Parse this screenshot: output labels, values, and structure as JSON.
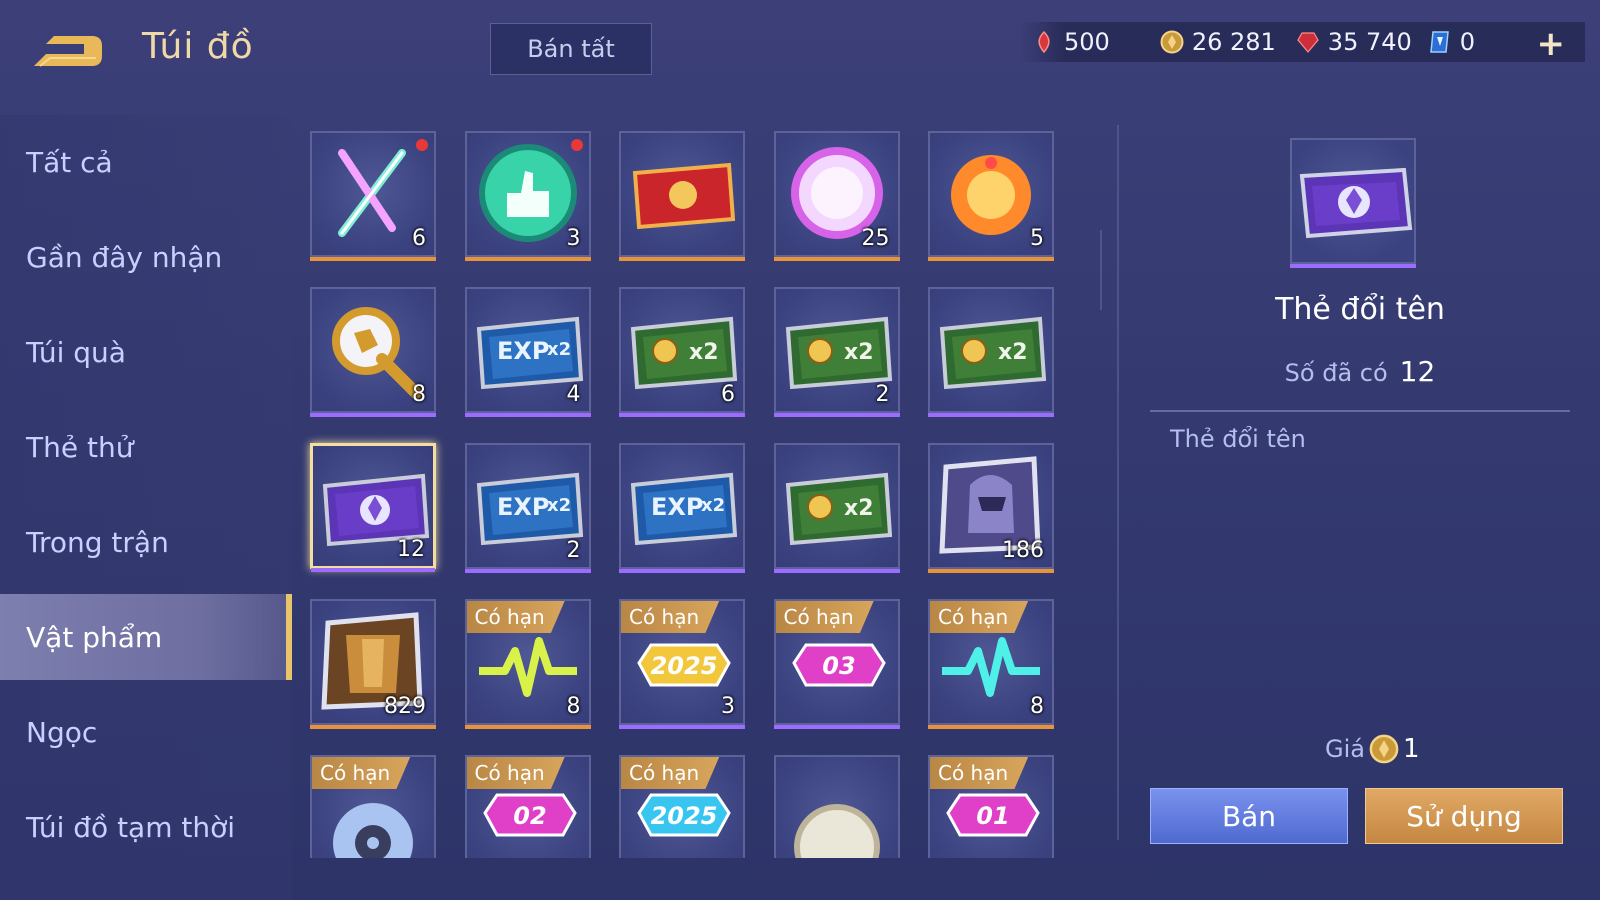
{
  "header": {
    "back_icon": "back-arrow-icon",
    "title": "Túi đồ",
    "sell_all_label": "Bán tất"
  },
  "currencies": [
    {
      "icon": "red-gem-icon",
      "value": "500",
      "color": "#e0484b"
    },
    {
      "icon": "gold-coin-icon",
      "value": "26 281",
      "color": "#e3b64b"
    },
    {
      "icon": "red-crystal-icon",
      "value": "35 740",
      "color": "#d9363c"
    },
    {
      "icon": "blue-voucher-icon",
      "value": "0",
      "color": "#5aa0ff"
    }
  ],
  "add_currency_label": "+",
  "sidebar": {
    "items": [
      {
        "label": "Tất cả"
      },
      {
        "label": "Gần đây nhận"
      },
      {
        "label": "Túi quà"
      },
      {
        "label": "Thẻ thử"
      },
      {
        "label": "Trong trận"
      },
      {
        "label": "Vật phẩm",
        "active": true
      },
      {
        "label": "Ngọc"
      },
      {
        "label": "Túi đồ tạm thời"
      }
    ]
  },
  "grid": {
    "limited_label": "Có hạn",
    "items": [
      {
        "icon": "crossed-lightsabers-icon",
        "count": "6",
        "rarity": "orange",
        "new": true
      },
      {
        "icon": "green-thumbs-up-icon",
        "count": "3",
        "rarity": "orange",
        "new": true
      },
      {
        "icon": "red-ticket-icon",
        "count": "",
        "rarity": "orange"
      },
      {
        "icon": "pink-orb-icon",
        "count": "25",
        "rarity": "orange"
      },
      {
        "icon": "fire-orb-icon",
        "count": "5",
        "rarity": "orange"
      },
      {
        "icon": "golden-scepter-icon",
        "count": "8",
        "rarity": "purple"
      },
      {
        "icon": "exp-x2-card-icon",
        "count": "4",
        "rarity": "purple",
        "card_text": "EXP x2"
      },
      {
        "icon": "gold-x2-card-icon",
        "count": "6",
        "rarity": "purple",
        "card_text": "x2"
      },
      {
        "icon": "gold-x2-card-icon",
        "count": "2",
        "rarity": "purple",
        "card_text": "x2"
      },
      {
        "icon": "gold-x2-card-icon",
        "count": "",
        "rarity": "purple",
        "card_text": "x2"
      },
      {
        "icon": "rename-card-icon",
        "count": "12",
        "rarity": "purple",
        "selected": true
      },
      {
        "icon": "exp-x2-card-icon",
        "count": "2",
        "rarity": "purple",
        "card_text": "EXP x2"
      },
      {
        "icon": "exp-x2-card-icon",
        "count": "",
        "rarity": "purple",
        "card_text": "EXP x2"
      },
      {
        "icon": "gold-x2-card-icon",
        "count": "",
        "rarity": "purple",
        "card_text": "x2"
      },
      {
        "icon": "purple-helmet-icon",
        "count": "186",
        "rarity": "orange"
      },
      {
        "icon": "golden-armor-icon",
        "count": "829",
        "rarity": "orange"
      },
      {
        "icon": "yellow-pulse-icon",
        "count": "8",
        "rarity": "orange",
        "limited": true
      },
      {
        "icon": "badge-2025-icon",
        "count": "3",
        "rarity": "purple",
        "limited": true,
        "badge_text": "2025"
      },
      {
        "icon": "badge-03-icon",
        "count": "",
        "rarity": "purple",
        "limited": true,
        "badge_text": "03"
      },
      {
        "icon": "cyan-pulse-icon",
        "count": "8",
        "rarity": "orange",
        "limited": true
      },
      {
        "icon": "blue-disc-icon",
        "count": "",
        "rarity": "orange",
        "limited": true
      },
      {
        "icon": "badge-02-icon",
        "count": "",
        "rarity": "orange",
        "limited": true,
        "badge_text": "02"
      },
      {
        "icon": "badge-2025-blue-icon",
        "count": "",
        "rarity": "orange",
        "limited": true,
        "badge_text": "2025"
      },
      {
        "icon": "silver-orb-icon",
        "count": "",
        "rarity": "orange"
      },
      {
        "icon": "badge-01-icon",
        "count": "",
        "rarity": "orange",
        "limited": true,
        "badge_text": "01"
      }
    ]
  },
  "detail": {
    "icon": "rename-card-icon",
    "name": "Thẻ đổi tên",
    "owned_label": "Số đã có",
    "owned_value": "12",
    "description": "Thẻ đổi tên",
    "price_label": "Giá",
    "price_icon": "gold-coin-icon",
    "price_value": "1",
    "sell_label": "Bán",
    "use_label": "Sử dụng"
  },
  "colors": {
    "rarity_orange": "#e8933a",
    "rarity_purple": "#9b6cff",
    "accent_gold": "#e8c46a"
  }
}
